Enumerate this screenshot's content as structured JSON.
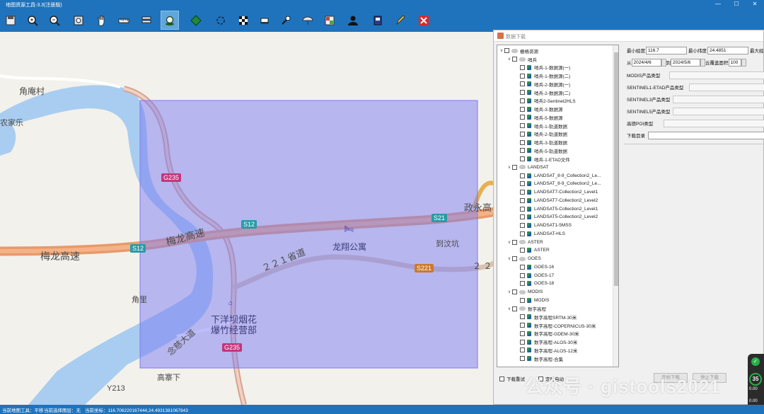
{
  "window": {
    "title": "地图资源工具-3.3(注册版)",
    "minimize": "—",
    "maximize": "☐",
    "close": "✕"
  },
  "toolbar": [
    {
      "name": "save-icon"
    },
    {
      "name": "zoom-in-icon"
    },
    {
      "name": "zoom-out-icon"
    },
    {
      "name": "full-extent-icon"
    },
    {
      "name": "pan-icon"
    },
    {
      "name": "measure-icon"
    },
    {
      "name": "layers-icon"
    },
    {
      "name": "place-icon",
      "active": true
    },
    {
      "name": "globe-icon"
    },
    {
      "name": "refresh-icon"
    },
    {
      "name": "grid-icon"
    },
    {
      "name": "eraser-icon"
    },
    {
      "name": "wrench-icon"
    },
    {
      "name": "umbrella-icon"
    },
    {
      "name": "tiles-icon"
    },
    {
      "name": "user-icon"
    },
    {
      "name": "info-icon"
    },
    {
      "name": "pencil-icon"
    },
    {
      "name": "close-icon"
    }
  ],
  "map": {
    "places": {
      "jiaoancun": "角庵村",
      "nongjiale": "农家乐",
      "jiaoli": "角里",
      "gaozhaixia": "高寨下",
      "daowenkeng": "到汶坑",
      "longxiang": "龙翔公寓",
      "xiayang1": "下洋坝烟花",
      "xiayang2": "爆竹经营部"
    },
    "roads": {
      "meilong_highway": "梅龙高速",
      "meilong_highway2": "梅龙高速",
      "zhengyong": "政永高",
      "provincial": "２２１省道",
      "s221_tail": "２ ２",
      "nianhuangdadao": "念慈大道"
    },
    "badges": {
      "g235_top": "G235",
      "g235_bottom": "G235",
      "s12_left": "S12",
      "s12_mid": "S12",
      "s21": "S21",
      "s221": "S221",
      "y213": "Y213"
    }
  },
  "dialog": {
    "title": "数据下载",
    "tree": [
      {
        "level": 0,
        "expander": "∨",
        "label": "栅格资源",
        "type": "folder"
      },
      {
        "level": 1,
        "expander": "∨",
        "label": "哨兵",
        "type": "folder"
      },
      {
        "level": 2,
        "label": "哨兵-1-数据源(一)",
        "type": "layer"
      },
      {
        "level": 2,
        "label": "哨兵-1-数据源(二)",
        "type": "layer"
      },
      {
        "level": 2,
        "label": "哨兵-2-数据源(一)",
        "type": "layer"
      },
      {
        "level": 2,
        "label": "哨兵-2-数据源(二)",
        "type": "layer"
      },
      {
        "level": 2,
        "label": "哨兵2-Sentinel2HLS",
        "type": "layer"
      },
      {
        "level": 2,
        "label": "哨兵-3-数据源",
        "type": "layer"
      },
      {
        "level": 2,
        "label": "哨兵-5-数据源",
        "type": "layer"
      },
      {
        "level": 2,
        "label": "哨兵-1-轨道数据",
        "type": "layer"
      },
      {
        "level": 2,
        "label": "哨兵-2-轨道数据",
        "type": "layer"
      },
      {
        "level": 2,
        "label": "哨兵-3-轨道数据",
        "type": "layer"
      },
      {
        "level": 2,
        "label": "哨兵-5-轨道数据",
        "type": "layer"
      },
      {
        "level": 2,
        "label": "哨兵-1-ETAD文件",
        "type": "layer"
      },
      {
        "level": 1,
        "expander": "∨",
        "label": "LANDSAT",
        "type": "folder"
      },
      {
        "level": 2,
        "label": "LANDSAT_8-9_Collection2_Le...",
        "type": "layer"
      },
      {
        "level": 2,
        "label": "LANDSAT_8-9_Collection2_Le...",
        "type": "layer"
      },
      {
        "level": 2,
        "label": "LANDSAT7-Collection2_Level1",
        "type": "layer"
      },
      {
        "level": 2,
        "label": "LANDSAT7-Collection2_Level2",
        "type": "layer"
      },
      {
        "level": 2,
        "label": "LANDSAT5-Collection2_Level1",
        "type": "layer"
      },
      {
        "level": 2,
        "label": "LANDSAT5-Collection2_Level2",
        "type": "layer"
      },
      {
        "level": 2,
        "label": "LANDSAT1-5MSS",
        "type": "layer"
      },
      {
        "level": 2,
        "label": "LANDSAT-HLS",
        "type": "layer"
      },
      {
        "level": 1,
        "expander": "∨",
        "label": "ASTER",
        "type": "folder"
      },
      {
        "level": 2,
        "label": "ASTER",
        "type": "layer"
      },
      {
        "level": 1,
        "expander": "∨",
        "label": "GOES",
        "type": "folder"
      },
      {
        "level": 2,
        "label": "GOES-16",
        "type": "layer"
      },
      {
        "level": 2,
        "label": "GOES-17",
        "type": "layer"
      },
      {
        "level": 2,
        "label": "GOES-18",
        "type": "layer"
      },
      {
        "level": 1,
        "expander": "∨",
        "label": "MODIS",
        "type": "folder"
      },
      {
        "level": 2,
        "label": "MODIS",
        "type": "layer"
      },
      {
        "level": 1,
        "expander": "∨",
        "label": "数字高程",
        "type": "folder"
      },
      {
        "level": 2,
        "label": "数字高程SRTM-30米",
        "type": "layer"
      },
      {
        "level": 2,
        "label": "数字高程-COPERNICUS-30米",
        "type": "layer"
      },
      {
        "level": 2,
        "label": "数字高程-GDEM-30米",
        "type": "layer"
      },
      {
        "level": 2,
        "label": "数字高程-ALOS-30米",
        "type": "layer"
      },
      {
        "level": 2,
        "label": "数字高程-ALOS-12米",
        "type": "layer"
      },
      {
        "level": 2,
        "label": "数字高程-合集",
        "type": "layer"
      }
    ],
    "form": {
      "min_lon_label": "最小经度",
      "min_lon_value": "116.7",
      "min_lat_label": "最小纬度",
      "min_lat_value": "24.4851",
      "max_lon_label": "最大经",
      "from_label": "从",
      "from_date": "2024/4/6",
      "to_label": "到",
      "to_date": "2024/5/6",
      "cloud_label": "云覆盖面积",
      "cloud_value": "100",
      "modis_label": "MODIS产品类型",
      "etad_label": "SENTINEL1-ETAD产品类型",
      "s3_label": "SENTINEL3产品类型",
      "s5_label": "SENTINEL5产品类型",
      "poi_label": "高德POI类型",
      "dir_label": "下载目录"
    },
    "bottom": {
      "retry_label": "下载重试",
      "timer_label": "定时自动",
      "start_btn": "开始下载",
      "stop_btn": "停止下载"
    }
  },
  "status": {
    "tool": "当前地图工具：平移",
    "layer": "当前选择图层：无",
    "coord": "当前坐标：116.706220167444,24.4931381067843"
  },
  "watermark": "公众号 · gistools2021",
  "widget": {
    "number": "35",
    "unit": "%",
    "speed1": "0.00",
    "speed2": "0.00"
  },
  "colors": {
    "selection": "#9f9ff2",
    "highway": "#e79a6b",
    "water": "#a9cdf0",
    "chrome": "#1f73bd"
  }
}
